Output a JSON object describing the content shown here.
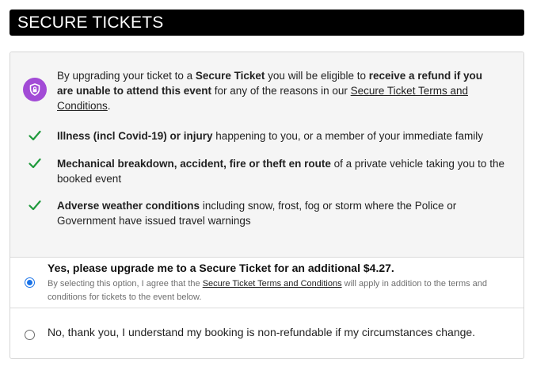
{
  "header": {
    "title": "SECURE TICKETS"
  },
  "intro": {
    "p1": "By upgrading your ticket to a ",
    "b1": "Secure Ticket",
    "p2": " you will be eligible to ",
    "b2": "receive a refund if you are unable to attend this event",
    "p3": " for any of the reasons in our ",
    "link": "Secure Ticket Terms and Conditions",
    "p4": "."
  },
  "reasons": [
    {
      "bold": "Illness (incl Covid-19) or injury",
      "rest": " happening to you, or a member of your immediate family"
    },
    {
      "bold": "Mechanical breakdown, accident, fire or theft en route",
      "rest": " of a private vehicle taking you to the booked event"
    },
    {
      "bold": "Adverse weather conditions",
      "rest": " including snow, frost, fog or storm where the Police or Government have issued travel warnings"
    }
  ],
  "options": {
    "yes": {
      "title": "Yes, please upgrade me to a Secure Ticket for an additional $4.27.",
      "sub_p1": "By selecting this option, I agree that the ",
      "sub_link": "Secure Ticket Terms and Conditions",
      "sub_p2": " will apply in addition to the terms and conditions for tickets to the event below.",
      "selected": true
    },
    "no": {
      "label": "No, thank you, I understand my booking is non-refundable if my circumstances change.",
      "selected": false
    }
  },
  "icons": {
    "badge": "shield-lock-icon",
    "check": "check-icon"
  },
  "colors": {
    "badge": "#a24bd6",
    "check": "#1f9a3c",
    "radio": "#1a73e8",
    "header": "#000000"
  }
}
